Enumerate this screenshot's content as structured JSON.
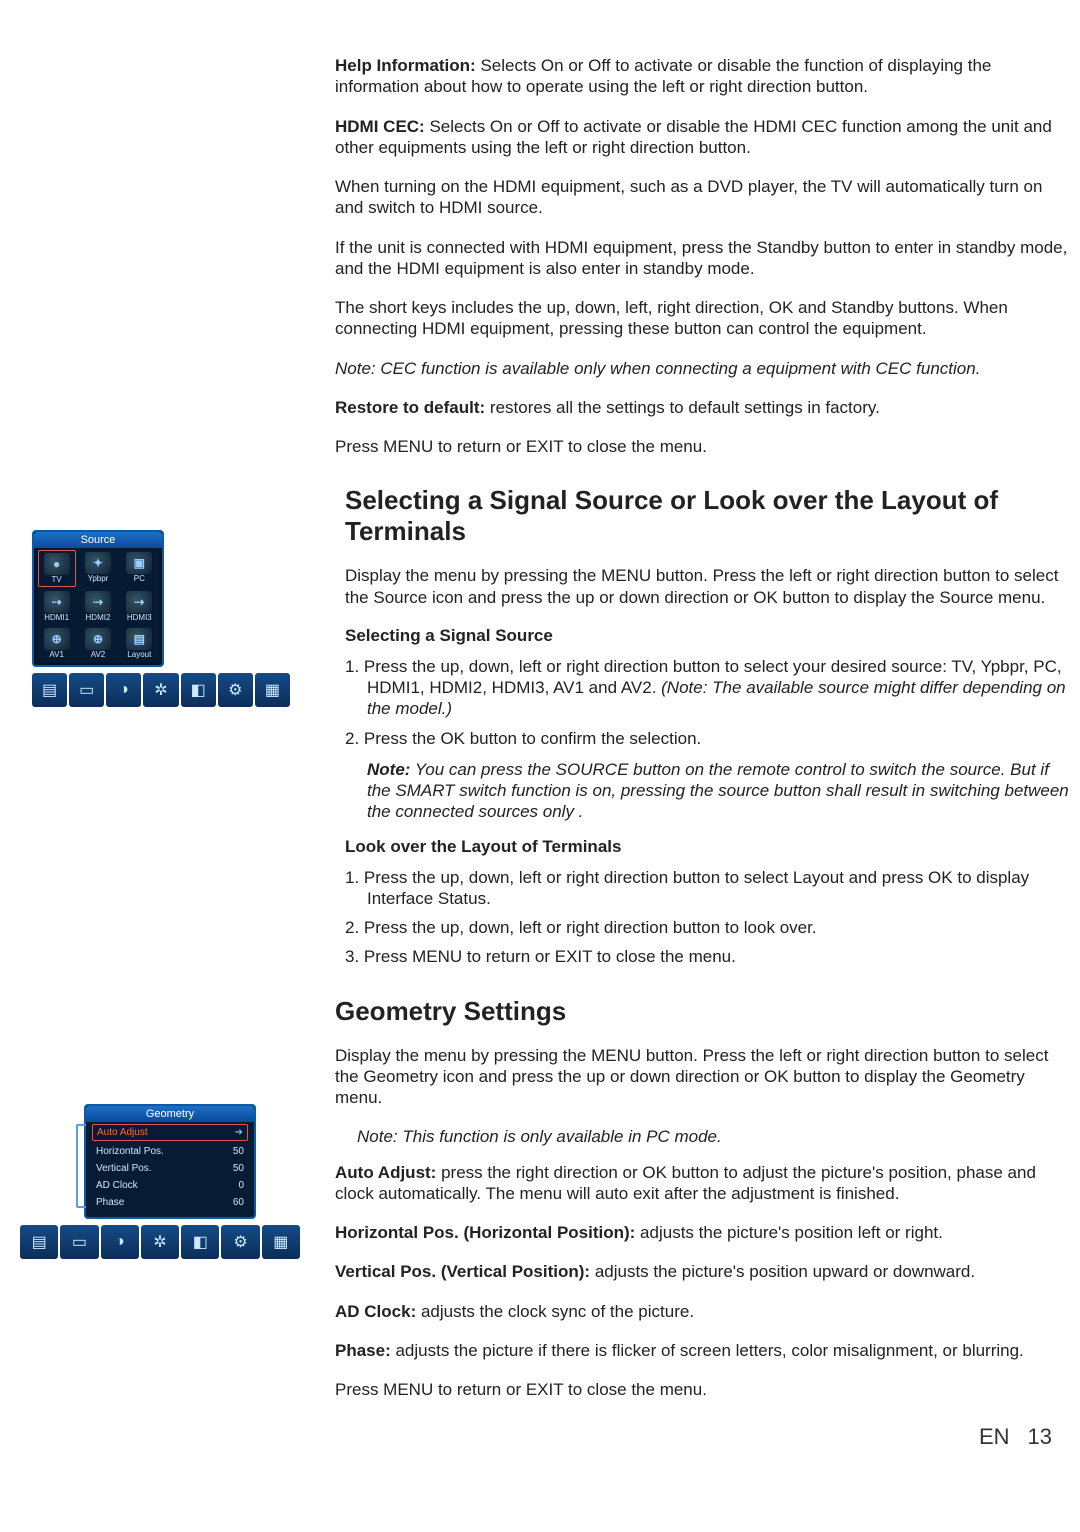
{
  "top": {
    "helpInfo": {
      "label": "Help Information:",
      "text": " Selects On or Off to activate or disable the function of displaying the information about how to operate using the left or right direction button."
    },
    "hdmiCec": {
      "label": "HDMI CEC:",
      "text": " Selects On or Off to activate or disable  the HDMI CEC function among the unit and other equipments using the left or right direction button."
    },
    "p3": "When turning on the HDMI equipment, such as a DVD player, the TV will automatically turn on and switch to HDMI source.",
    "p4": "If the unit is connected with HDMI equipment, press the Standby button to enter in standby mode, and the HDMI equipment is also enter in standby mode.",
    "p5": "The short keys includes the up, down, left, right direction, OK and Standby buttons. When connecting HDMI equipment, pressing these button can control the equipment.",
    "p6": "Note: CEC function is available only when connecting a equipment with CEC function.",
    "restore": {
      "label": "Restore to default:",
      "text": " restores all the settings to default settings in factory."
    },
    "p8": "Press MENU to return or EXIT to close the menu."
  },
  "source": {
    "heading": "Selecting a Signal Source or Look over the Layout of Terminals",
    "intro": "Display the menu by pressing the MENU button. Press the left or right direction button to select the Source icon and press the up or down direction or OK button to display the Source menu.",
    "subhead1": "Selecting a Signal Source",
    "list1": [
      {
        "num": "1. ",
        "body": "Press the up, down, left or right direction button to select your desired source: TV, Ypbpr, PC, HDMI1, HDMI2, HDMI3, AV1 and AV2. ",
        "noteLabel": "(Note: ",
        "noteBody": "The available source might differ depending on the model.)"
      },
      {
        "num": "2. ",
        "body": "Press the OK button to confirm the selection."
      }
    ],
    "note": {
      "label": "Note:",
      "body": " You can press the SOURCE button on the remote control to switch the source. But if the SMART switch function is on, pressing the source button shall result in switching between the connected sources only ."
    },
    "subhead2": "Look over the Layout of Terminals",
    "list2": [
      {
        "num": "1. ",
        "body": "Press the up, down, left or right direction button to select Layout and press OK to display Interface Status."
      },
      {
        "num": "2. ",
        "body": "Press the up, down, left or right direction button to look over."
      },
      {
        "num": "3. ",
        "body": "Press MENU to return or EXIT to close the menu."
      }
    ]
  },
  "geometry": {
    "heading": "Geometry Settings",
    "intro": "Display the menu by pressing the MENU button. Press the left or right direction button to select the Geometry icon and press the up or down direction or OK button to display the Geometry menu.",
    "note": "Note: This function is only available in PC mode.",
    "auto": {
      "label": "Auto Adjust:",
      "text": " press the right direction or OK button to adjust the picture's position, phase and clock automatically. The menu will auto exit after the adjustment is finished."
    },
    "hpos": {
      "label": "Horizontal Pos. (Horizontal Position):",
      "text": " adjusts the picture's position left or right."
    },
    "vpos": {
      "label": "Vertical Pos. (Vertical Position): ",
      "text": "adjusts the picture's position upward or downward."
    },
    "clock": {
      "label": "AD Clock:",
      "text": " adjusts the clock sync of the picture."
    },
    "phase": {
      "label": "Phase:",
      "text": " adjusts the picture if there is flicker of screen letters, color misalignment, or blurring."
    },
    "exit": "Press MENU to return or EXIT to close the menu."
  },
  "sourceFig": {
    "title": "Source",
    "items": [
      {
        "label": "TV",
        "glyph": "●",
        "sel": true
      },
      {
        "label": "Ypbpr",
        "glyph": "✦"
      },
      {
        "label": "PC",
        "glyph": "▣"
      },
      {
        "label": "HDMI1",
        "glyph": "⇢"
      },
      {
        "label": "HDMI2",
        "glyph": "⇢"
      },
      {
        "label": "HDMI3",
        "glyph": "⇢"
      },
      {
        "label": "AV1",
        "glyph": "⊕"
      },
      {
        "label": "AV2",
        "glyph": "⊕"
      },
      {
        "label": "Layout",
        "glyph": "▤"
      }
    ]
  },
  "geoFig": {
    "title": "Geometry",
    "items": [
      {
        "label": "Auto Adjust",
        "value": "➜",
        "sel": true
      },
      {
        "label": "Horizontal Pos.",
        "value": "50"
      },
      {
        "label": "Vertical Pos.",
        "value": "50"
      },
      {
        "label": "AD Clock",
        "value": "0"
      },
      {
        "label": "Phase",
        "value": "60"
      }
    ]
  },
  "iconbar": [
    "▤",
    "▭",
    "◑",
    "✲",
    "◧",
    "⚙",
    "▦"
  ],
  "footer": {
    "lang": "EN",
    "page": "13"
  }
}
